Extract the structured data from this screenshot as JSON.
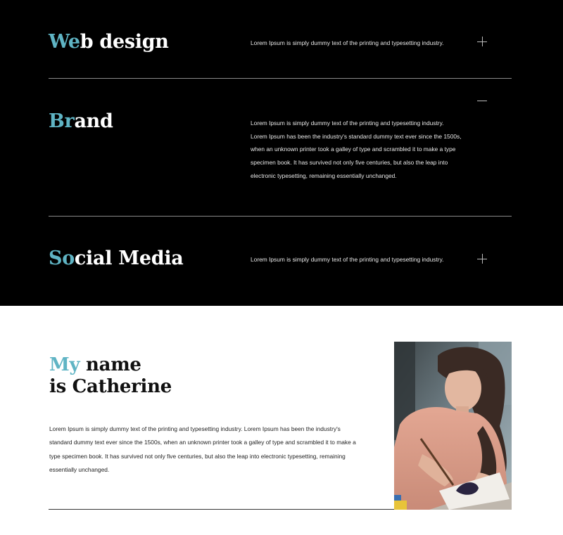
{
  "services": [
    {
      "title_highlight": "We",
      "title_rest": "b design",
      "description": "Lorem Ipsum is simply dummy text of the printing and typesetting industry.",
      "toggle": "plus-icon",
      "expanded": false
    },
    {
      "title_highlight": "Br",
      "title_rest": "and",
      "description": "Lorem Ipsum is simply dummy text of the printing and typesetting industry. Lorem Ipsum has been the industry's standard dummy text ever since the 1500s, when an unknown printer took a galley of type and scrambled it to make a type specimen book. It has survived not only five centuries, but also the leap into electronic typesetting, remaining essentially unchanged.",
      "toggle": "minus-icon",
      "expanded": true
    },
    {
      "title_highlight": "So",
      "title_rest": "cial Media",
      "description": "Lorem Ipsum is simply dummy text of the printing and typesetting industry.",
      "toggle": "plus-icon",
      "expanded": false
    }
  ],
  "about": {
    "heading_highlight": "My",
    "heading_line1_rest": " name",
    "heading_line2": "is Catherine",
    "body": "Lorem Ipsum is simply dummy text of the printing and typesetting industry. Lorem Ipsum has been the industry's standard dummy text ever since the 1500s, when an unknown printer took a galley of type and scrambled it to make a type specimen book. It has survived not only five centuries, but also the leap into electronic typesetting, remaining essentially unchanged."
  },
  "colors": {
    "accent": "#5fb4c4",
    "dark_bg": "#000000",
    "light_bg": "#ffffff"
  }
}
